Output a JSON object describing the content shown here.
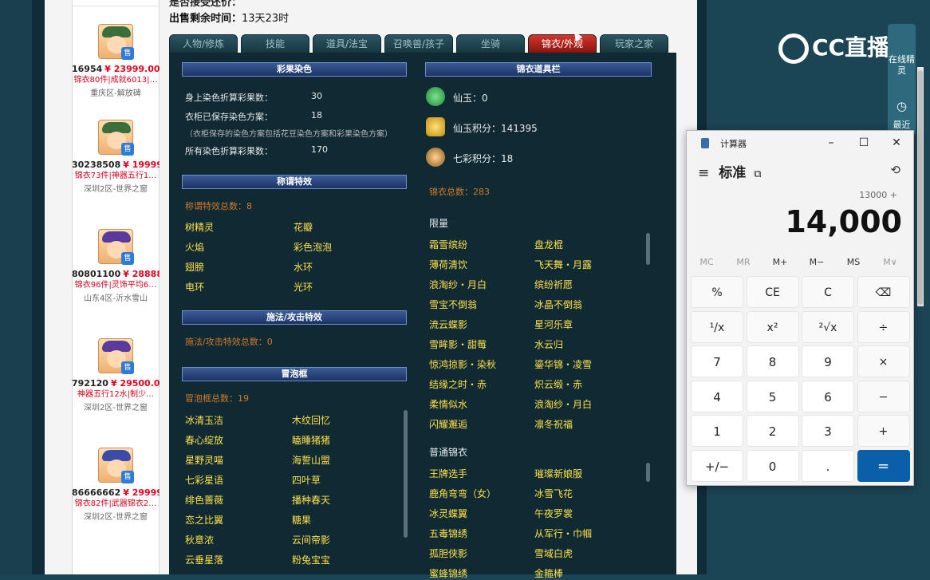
{
  "sale_top": "是否接受还价：",
  "sale_info": {
    "label": "出售剩余时间：",
    "value": "13天23时"
  },
  "listings": [
    {
      "id": "16954",
      "price": "¥ 23999.00",
      "tags": "锦衣80件|成就6013|…",
      "server": "重庆区-解放碑",
      "avatar": "green"
    },
    {
      "id": "30238508",
      "price": "¥ 19999.00",
      "tags": "锦衣73件|神器五行1…",
      "server": "深圳2区-世界之窗",
      "avatar": "green"
    },
    {
      "id": "80801100",
      "price": "¥ 28888.00",
      "tags": "锦衣96件|灵饰平均6…",
      "server": "山东4区-沂水雪山",
      "avatar": "purple"
    },
    {
      "id": "792120",
      "price": "¥ 29500.00",
      "tags": "神器五行12水|制少…",
      "server": "深圳2区-世界之窗",
      "avatar": "purple"
    },
    {
      "id": "86666662",
      "price": "¥ 29999.00",
      "tags": "锦衣82件|武器锦衣2…",
      "server": "深圳2区-世界之窗",
      "avatar": "blue"
    }
  ],
  "tabs": [
    "人物/修炼",
    "技能",
    "道具/法宝",
    "召唤兽/孩子",
    "坐骑",
    "锦衣/外观",
    "玩家之家"
  ],
  "active_tab": "锦衣/外观",
  "color_section": {
    "header": "彩果染色",
    "rows": [
      {
        "label": "身上染色折算彩果数：",
        "value": "30"
      },
      {
        "label": "衣柜已保存染色方案：",
        "value": "18"
      },
      {
        "label": "所有染色折算彩果数：",
        "value": "170"
      }
    ],
    "note": "（衣柜保存的染色方案包括花豆染色方案和彩果染色方案）"
  },
  "title_section": {
    "header": "称谓特效",
    "total": "称谓特效总数：8",
    "items": [
      "树精灵",
      "花瓣",
      "火焰",
      "彩色泡泡",
      "翅膀",
      "水环",
      "电环",
      "光环"
    ]
  },
  "spell_section": {
    "header": "施法/攻击特效",
    "total": "施法/攻击特效总数：0"
  },
  "bubble_section": {
    "header": "冒泡框",
    "total": "冒泡框总数：19",
    "items": [
      "冰清玉洁",
      "木纹回忆",
      "春心绽放",
      "瞌睡猪猪",
      "星野灵喵",
      "海誓山盟",
      "七彩星语",
      "四叶草",
      "绯色蔷薇",
      "播种春天",
      "恋之比翼",
      "糖果",
      "秋意浓",
      "云间帝影",
      "云垂星落",
      "粉兔宝宝"
    ]
  },
  "wardrobe_section": {
    "header": "锦衣道具栏",
    "currencies": [
      {
        "label": "仙玉：0",
        "icon": "jade-icon",
        "color": "#2aa84a"
      },
      {
        "label": "仙玉积分：141395",
        "icon": "points-icon",
        "color": "#d9a520"
      },
      {
        "label": "七彩积分：18",
        "icon": "rainbow-icon",
        "color": "#c98a30"
      }
    ],
    "total": "锦衣总数：283",
    "limited_title": "限量",
    "limited_items": [
      "霜雪缤纷",
      "盘龙棍",
      "薄荷清饮",
      "飞天舞・月露",
      "浪淘纱・月白",
      "缤纷祈愿",
      "雪宝不倒翁",
      "冰晶不倒翁",
      "流云蝶影",
      "星河乐章",
      "雪眸影・甜莓",
      "水云归",
      "惊鸿掠影・染秋",
      "鎏华锦・凌雪",
      "结缘之时・赤",
      "炽云缎・赤",
      "柔情似水",
      "浪淘纱・月白",
      "闪耀邂逅",
      "凛冬祝福"
    ],
    "normal_title": "普通锦衣",
    "normal_items": [
      "王牌选手",
      "璀璨新娘服",
      "鹿角弯弯（女）",
      "冰雪飞花",
      "冰灵蝶翼",
      "午夜罗裳",
      "五毒锦绣",
      "从军行・巾帼",
      "孤胆侠影",
      "雪域白虎",
      "蜜蜂锦绣",
      "金箍棒"
    ]
  },
  "cc_logo": "CC直播",
  "side_panel": {
    "btn1": "在线精灵",
    "btn2": "最近"
  },
  "calculator": {
    "title": "计算器",
    "mode": "标准",
    "expression": "13000 +",
    "display": "14,000",
    "memory": [
      "MC",
      "MR",
      "M+",
      "M−",
      "MS",
      "M∨"
    ],
    "keys": [
      "%",
      "CE",
      "C",
      "⌫",
      "¹/x",
      "x²",
      "²√x",
      "÷",
      "7",
      "8",
      "9",
      "×",
      "4",
      "5",
      "6",
      "−",
      "1",
      "2",
      "3",
      "+",
      "+/−",
      "0",
      ".",
      "="
    ],
    "accent": "#0a5fa8"
  }
}
